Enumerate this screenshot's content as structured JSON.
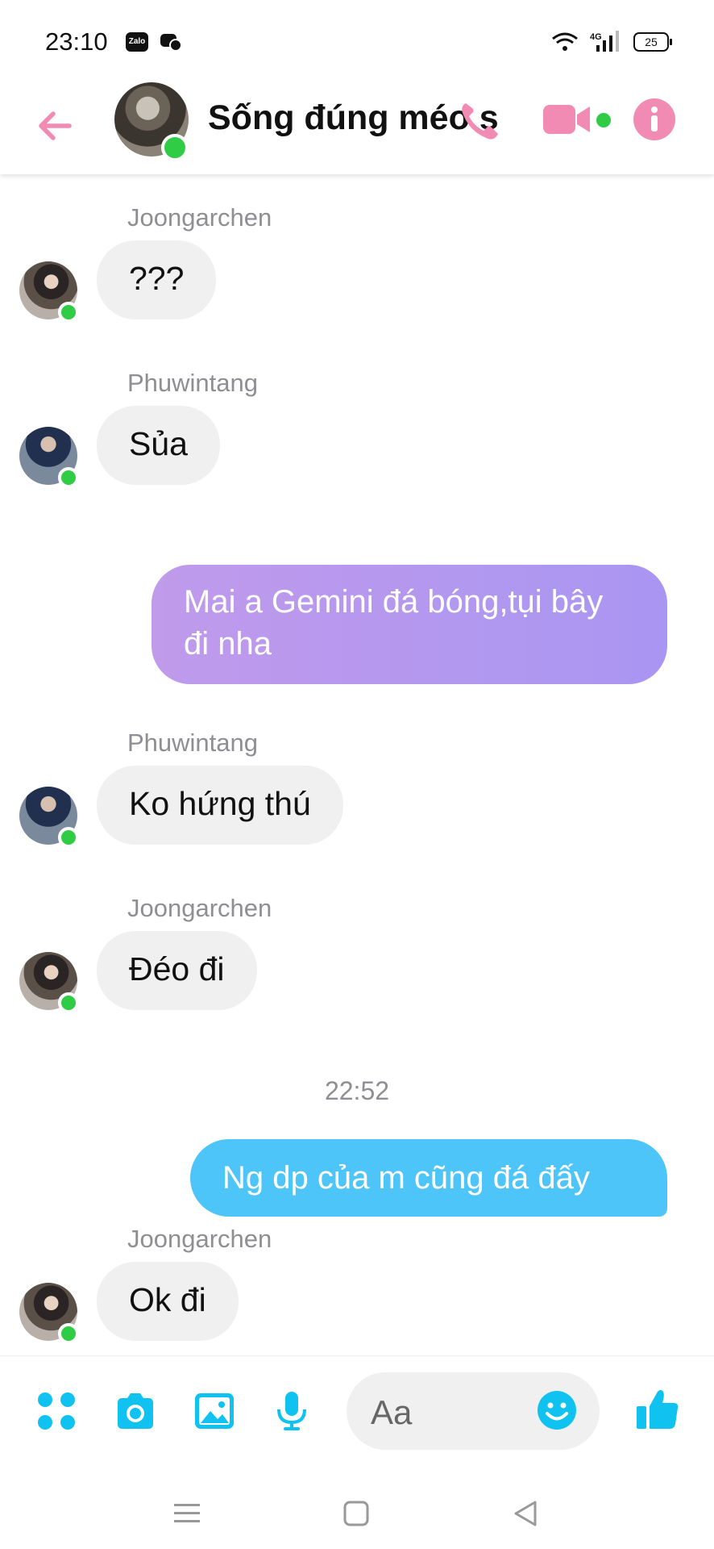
{
  "status": {
    "time": "23:10",
    "battery": "25",
    "network": "4G",
    "app1": "Zalo"
  },
  "header": {
    "title": "Sống đúng méo s"
  },
  "messages": {
    "m1": {
      "sender": "Joongarchen",
      "text": "???"
    },
    "m2": {
      "sender": "Phuwintang",
      "text": "Sủa"
    },
    "m3": {
      "text": "Mai a Gemini đá bóng,tụi bây đi nha"
    },
    "m4": {
      "sender": "Phuwintang",
      "text": "Ko hứng thú"
    },
    "m5": {
      "sender": "Joongarchen",
      "text": "Đéo đi"
    },
    "timestamp": "22:52",
    "m6": {
      "text": "Ng dp của m cũng đá đấy"
    },
    "m7": {
      "sender": "Joongarchen",
      "text": "Ok đi"
    }
  },
  "composer": {
    "placeholder": "Aa"
  },
  "colors": {
    "accent_blue": "#0fc2f0",
    "accent_pink": "#f28bb3",
    "online": "#31cc46",
    "outgoing_purple": "#b59af0",
    "outgoing_blue": "#4ec5f8"
  }
}
